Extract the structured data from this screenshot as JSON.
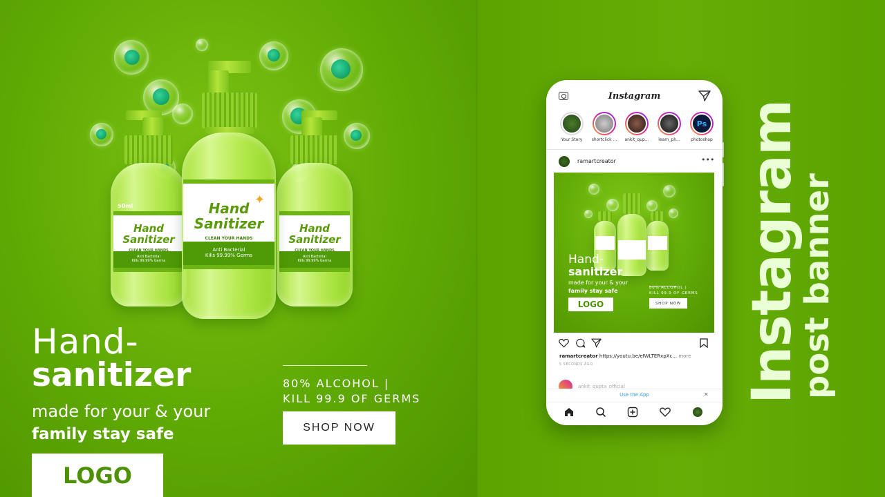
{
  "banner": {
    "bottle_capacity": "50ml",
    "bottle_title_line1": "Hand",
    "bottle_title_line2": "Sanitizer",
    "bottle_subtitle": "CLEAN YOUR HANDS",
    "bottle_strip_line1": "Anti Bacterial",
    "bottle_strip_line2": "Kills 99.99% Germs",
    "headline_line1": "Hand-",
    "headline_line2": "sanitizer",
    "tagline_line1": "made for your & your",
    "tagline_line2": "family stay safe",
    "logo": "LOGO",
    "feature_line1": "80% ALCOHOL  |",
    "feature_line2": "KILL 99.9 OF GERMS",
    "cta_label": "SHOP NOW"
  },
  "phone": {
    "app_title": "Instagram",
    "stories": [
      {
        "name": "Your Story"
      },
      {
        "name": "shortclick ..."
      },
      {
        "name": "ankit_qup..."
      },
      {
        "name": "learn_ph..."
      },
      {
        "name": "photoshop"
      }
    ],
    "post_user": "ramartcreator",
    "caption_user": "ramartcreator",
    "caption_text": "https://youtu.be/eIWLTERxpXc...",
    "caption_more": "more",
    "time_ago": "5 SECONDS AGO",
    "next_post_user": "ankit_qupta_official",
    "use_app": "Use the App",
    "photoshop_badge": "Ps"
  },
  "side_title": {
    "line1": "Instagram",
    "line2": "post banner"
  },
  "colors": {
    "background_green": "#5fa806",
    "text_light": "#eaffd6",
    "logo_green": "#4c9106",
    "story_ring": "#d6249f",
    "link_blue": "#3897f0"
  }
}
